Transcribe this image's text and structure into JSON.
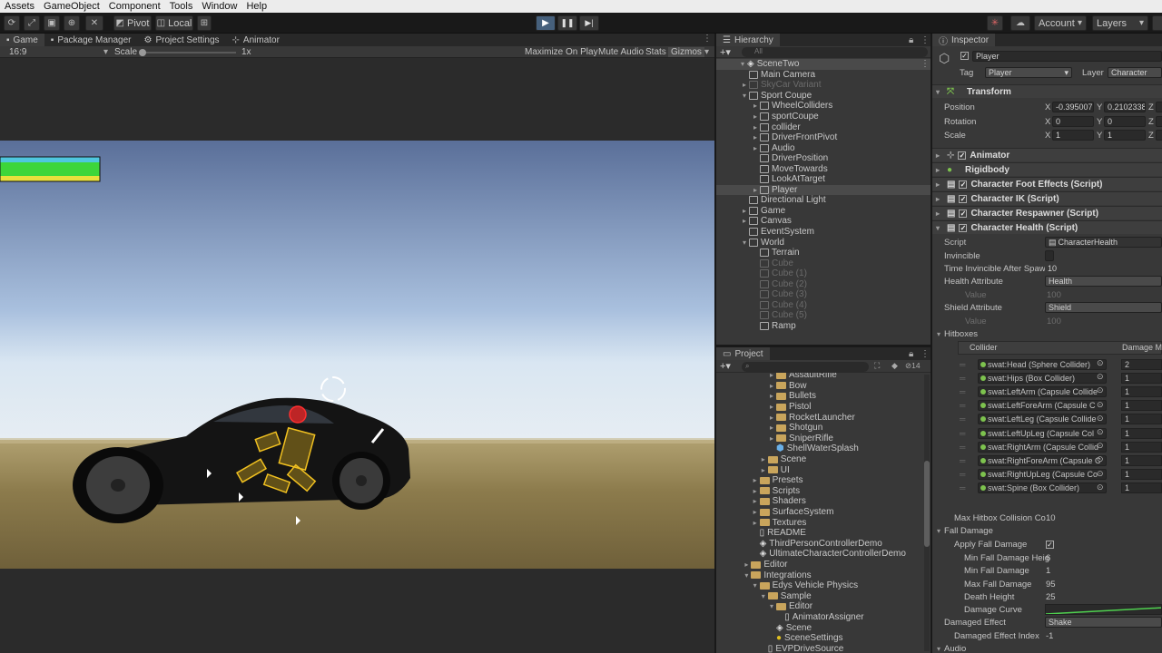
{
  "menu": [
    "Assets",
    "GameObject",
    "Component",
    "Tools",
    "Window",
    "Help"
  ],
  "toolbar": {
    "pivot": "Pivot",
    "local": "Local",
    "account": "Account",
    "layers": "Layers"
  },
  "game_tabs": [
    "Game",
    "Package Manager",
    "Project Settings",
    "Animator"
  ],
  "game_bar": {
    "aspect": "16:9",
    "scale_label": "Scale",
    "scale_value": "1x",
    "maximize": "Maximize On Play",
    "mute": "Mute Audio",
    "stats": "Stats",
    "gizmos": "Gizmos"
  },
  "hierarchy": {
    "title": "Hierarchy",
    "search_placeholder": "All",
    "scene": "SceneTwo",
    "items": [
      {
        "label": "Main Camera",
        "indent": 1,
        "dim": false,
        "arrow": ""
      },
      {
        "label": "SkyCar Variant",
        "indent": 1,
        "dim": true,
        "arrow": "▸"
      },
      {
        "label": "Sport Coupe",
        "indent": 1,
        "dim": false,
        "arrow": "▾"
      },
      {
        "label": "WheelColliders",
        "indent": 2,
        "dim": false,
        "arrow": "▸"
      },
      {
        "label": "sportCoupe",
        "indent": 2,
        "dim": false,
        "arrow": "▸"
      },
      {
        "label": "collider",
        "indent": 2,
        "dim": false,
        "arrow": "▸"
      },
      {
        "label": "DriverFrontPivot",
        "indent": 2,
        "dim": false,
        "arrow": "▸"
      },
      {
        "label": "Audio",
        "indent": 2,
        "dim": false,
        "arrow": "▸"
      },
      {
        "label": "DriverPosition",
        "indent": 2,
        "dim": false,
        "arrow": ""
      },
      {
        "label": "MoveTowards",
        "indent": 2,
        "dim": false,
        "arrow": ""
      },
      {
        "label": "LookAtTarget",
        "indent": 2,
        "dim": false,
        "arrow": ""
      },
      {
        "label": "Player",
        "indent": 2,
        "dim": false,
        "arrow": "▸"
      },
      {
        "label": "Directional Light",
        "indent": 1,
        "dim": false,
        "arrow": ""
      },
      {
        "label": "Game",
        "indent": 1,
        "dim": false,
        "arrow": "▸"
      },
      {
        "label": "Canvas",
        "indent": 1,
        "dim": false,
        "arrow": "▸"
      },
      {
        "label": "EventSystem",
        "indent": 1,
        "dim": false,
        "arrow": ""
      },
      {
        "label": "World",
        "indent": 1,
        "dim": false,
        "arrow": "▾"
      },
      {
        "label": "Terrain",
        "indent": 2,
        "dim": false,
        "arrow": ""
      },
      {
        "label": "Cube",
        "indent": 2,
        "dim": true,
        "arrow": ""
      },
      {
        "label": "Cube (1)",
        "indent": 2,
        "dim": true,
        "arrow": ""
      },
      {
        "label": "Cube (2)",
        "indent": 2,
        "dim": true,
        "arrow": ""
      },
      {
        "label": "Cube (3)",
        "indent": 2,
        "dim": true,
        "arrow": ""
      },
      {
        "label": "Cube (4)",
        "indent": 2,
        "dim": true,
        "arrow": ""
      },
      {
        "label": "Cube (5)",
        "indent": 2,
        "dim": true,
        "arrow": ""
      },
      {
        "label": "Ramp",
        "indent": 2,
        "dim": false,
        "arrow": ""
      }
    ]
  },
  "project": {
    "title": "Project",
    "count": "14",
    "items": [
      {
        "label": "AssaultRifle",
        "indent": 5,
        "type": "folder",
        "arrow": "▸"
      },
      {
        "label": "Bow",
        "indent": 5,
        "type": "folder",
        "arrow": "▸"
      },
      {
        "label": "Bullets",
        "indent": 5,
        "type": "folder",
        "arrow": "▸"
      },
      {
        "label": "Pistol",
        "indent": 5,
        "type": "folder",
        "arrow": "▸"
      },
      {
        "label": "RocketLauncher",
        "indent": 5,
        "type": "folder",
        "arrow": "▸"
      },
      {
        "label": "Shotgun",
        "indent": 5,
        "type": "folder",
        "arrow": "▸"
      },
      {
        "label": "SniperRifle",
        "indent": 5,
        "type": "folder",
        "arrow": "▸"
      },
      {
        "label": "ShellWaterSplash",
        "indent": 5,
        "type": "prefab",
        "arrow": ""
      },
      {
        "label": "Scene",
        "indent": 4,
        "type": "folder",
        "arrow": "▸"
      },
      {
        "label": "UI",
        "indent": 4,
        "type": "folder",
        "arrow": "▸"
      },
      {
        "label": "Presets",
        "indent": 3,
        "type": "folder",
        "arrow": "▸"
      },
      {
        "label": "Scripts",
        "indent": 3,
        "type": "folder",
        "arrow": "▸"
      },
      {
        "label": "Shaders",
        "indent": 3,
        "type": "folder",
        "arrow": "▸"
      },
      {
        "label": "SurfaceSystem",
        "indent": 3,
        "type": "folder",
        "arrow": "▸"
      },
      {
        "label": "Textures",
        "indent": 3,
        "type": "folder",
        "arrow": "▸"
      },
      {
        "label": "README",
        "indent": 3,
        "type": "file",
        "arrow": ""
      },
      {
        "label": "ThirdPersonControllerDemo",
        "indent": 3,
        "type": "scene",
        "arrow": ""
      },
      {
        "label": "UltimateCharacterControllerDemo",
        "indent": 3,
        "type": "scene",
        "arrow": ""
      },
      {
        "label": "Editor",
        "indent": 2,
        "type": "folder",
        "arrow": "▸"
      },
      {
        "label": "Integrations",
        "indent": 2,
        "type": "folder",
        "arrow": "▾"
      },
      {
        "label": "Edys Vehicle Physics",
        "indent": 3,
        "type": "folder",
        "arrow": "▾"
      },
      {
        "label": "Sample",
        "indent": 4,
        "type": "folder",
        "arrow": "▾"
      },
      {
        "label": "Editor",
        "indent": 5,
        "type": "folder",
        "arrow": "▾"
      },
      {
        "label": "AnimatorAssigner",
        "indent": 6,
        "type": "file",
        "arrow": ""
      },
      {
        "label": "Scene",
        "indent": 5,
        "type": "scene",
        "arrow": ""
      },
      {
        "label": "SceneSettings",
        "indent": 5,
        "type": "settings",
        "arrow": ""
      },
      {
        "label": "EVPDriveSource",
        "indent": 4,
        "type": "file",
        "arrow": ""
      }
    ]
  },
  "inspector": {
    "title": "Inspector",
    "object": "Player",
    "tag_label": "Tag",
    "tag": "Player",
    "layer_label": "Layer",
    "layer": "Character",
    "transform": "Transform",
    "position_label": "Position",
    "rotation_label": "Rotation",
    "scale_label": "Scale",
    "pos": {
      "x": "-0.395007",
      "y": "0.2102338",
      "z": ""
    },
    "rot": {
      "x": "0",
      "y": "0",
      "z": ""
    },
    "scl": {
      "x": "1",
      "y": "1",
      "z": ""
    },
    "components": [
      "Animator",
      "Rigidbody",
      "Character Foot Effects (Script)",
      "Character IK (Script)",
      "Character Respawner (Script)",
      "Character Health (Script)"
    ],
    "script_label": "Script",
    "script": "CharacterHealth",
    "invincible": "Invincible",
    "time_inv_label": "Time Invincible After Spaw",
    "time_inv": "10",
    "health_attr_label": "Health Attribute",
    "health_attr": "Health",
    "value_label": "Value",
    "health_value": "100",
    "shield_attr_label": "Shield Attribute",
    "shield_attr": "Shield",
    "shield_value": "100",
    "hitboxes_label": "Hitboxes",
    "collider_col": "Collider",
    "damage_col": "Damage M",
    "hitboxes": [
      {
        "collider": "swat:Head (Sphere Collider)",
        "damage": "2"
      },
      {
        "collider": "swat:Hips (Box Collider)",
        "damage": "1"
      },
      {
        "collider": "swat:LeftArm (Capsule Collide",
        "damage": "1"
      },
      {
        "collider": "swat:LeftForeArm (Capsule C",
        "damage": "1"
      },
      {
        "collider": "swat:LeftLeg (Capsule Collide",
        "damage": "1"
      },
      {
        "collider": "swat:LeftUpLeg (Capsule Col",
        "damage": "1"
      },
      {
        "collider": "swat:RightArm (Capsule Collid",
        "damage": "1"
      },
      {
        "collider": "swat:RightForeArm (Capsule C",
        "damage": "1"
      },
      {
        "collider": "swat:RightUpLeg (Capsule Co",
        "damage": "1"
      },
      {
        "collider": "swat:Spine (Box Collider)",
        "damage": "1"
      }
    ],
    "max_hitbox_label": "Max Hitbox Collision Co",
    "max_hitbox": "10",
    "fall_damage_label": "Fall Damage",
    "apply_fall_label": "Apply Fall Damage",
    "min_fall_height_label": "Min Fall Damage Heig",
    "min_fall_height": "6",
    "min_fall_label": "Min Fall Damage",
    "min_fall": "1",
    "max_fall_label": "Max Fall Damage",
    "max_fall": "95",
    "death_height_label": "Death Height",
    "death_height": "25",
    "damage_curve_label": "Damage Curve",
    "damaged_effect_label": "Damaged Effect",
    "damaged_effect": "Shake",
    "damaged_index_label": "Damaged Effect Index",
    "damaged_index": "-1",
    "audio_label": "Audio"
  }
}
